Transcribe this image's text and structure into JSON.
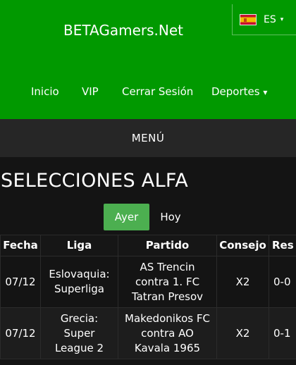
{
  "header": {
    "site_title": "BETAGamers.Net",
    "language": {
      "code": "ES",
      "caret": "▾",
      "flag": "spain-flag"
    },
    "nav": [
      {
        "label": "Inicio"
      },
      {
        "label": "VIP"
      },
      {
        "label": "Cerrar Sesión"
      },
      {
        "label": "Deportes",
        "caret": "▾"
      }
    ],
    "background": "#019900"
  },
  "menu": {
    "label": "MENÚ"
  },
  "section": {
    "title": "SELECCIONES ALFA"
  },
  "day_tabs": [
    {
      "label": "Ayer",
      "active": true
    },
    {
      "label": "Hoy",
      "active": false
    }
  ],
  "table": {
    "columns": [
      "Fecha",
      "Liga",
      "Partido",
      "Consejo",
      "Res"
    ],
    "rows": [
      {
        "fecha": "07/12",
        "liga": "Eslovaquia: Superliga",
        "partido": "AS Trencin contra 1. FC Tatran Presov",
        "consejo": "X2",
        "res": "0-0"
      },
      {
        "fecha": "07/12",
        "liga": "Grecia: Super League 2",
        "partido": "Makedonikos FC contra AO Kavala 1965",
        "consejo": "X2",
        "res": "0-1"
      }
    ]
  },
  "colors": {
    "accent": "#4caf50",
    "page_bg": "#141414",
    "menu_bg": "#262626"
  }
}
